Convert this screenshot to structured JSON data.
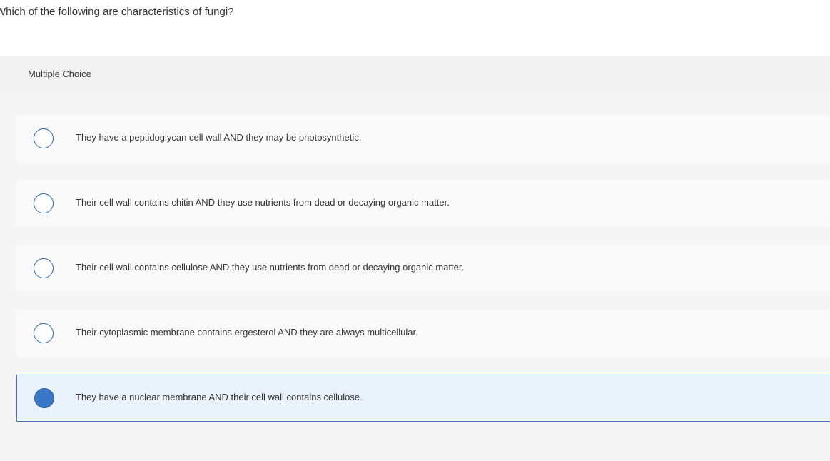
{
  "question": {
    "text": "Which of the following are characteristics of fungi?"
  },
  "section": {
    "label": "Multiple Choice"
  },
  "choices": [
    {
      "text": "They have a peptidoglycan cell wall AND they may be photosynthetic.",
      "selected": false
    },
    {
      "text": "Their cell wall contains chitin AND they use nutrients from dead or decaying organic matter.",
      "selected": false
    },
    {
      "text": "Their cell wall contains cellulose AND they use nutrients from dead or decaying organic matter.",
      "selected": false
    },
    {
      "text": "Their cytoplasmic membrane contains ergesterol AND they are always multicellular.",
      "selected": false
    },
    {
      "text": "They have a nuclear membrane AND their cell wall contains cellulose.",
      "selected": true
    }
  ],
  "colors": {
    "accent": "#2a67b1",
    "selected_background": "#e9f1fa",
    "selected_fill": "#3a78c7"
  }
}
